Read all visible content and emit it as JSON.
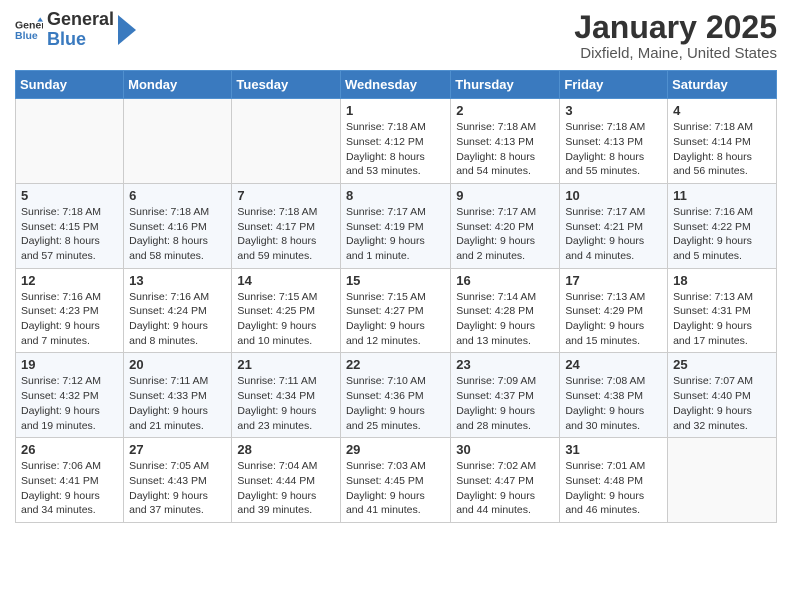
{
  "header": {
    "logo_general": "General",
    "logo_blue": "Blue",
    "month_title": "January 2025",
    "location": "Dixfield, Maine, United States"
  },
  "weekdays": [
    "Sunday",
    "Monday",
    "Tuesday",
    "Wednesday",
    "Thursday",
    "Friday",
    "Saturday"
  ],
  "weeks": [
    [
      {
        "day": "",
        "info": ""
      },
      {
        "day": "",
        "info": ""
      },
      {
        "day": "",
        "info": ""
      },
      {
        "day": "1",
        "info": "Sunrise: 7:18 AM\nSunset: 4:12 PM\nDaylight: 8 hours\nand 53 minutes."
      },
      {
        "day": "2",
        "info": "Sunrise: 7:18 AM\nSunset: 4:13 PM\nDaylight: 8 hours\nand 54 minutes."
      },
      {
        "day": "3",
        "info": "Sunrise: 7:18 AM\nSunset: 4:13 PM\nDaylight: 8 hours\nand 55 minutes."
      },
      {
        "day": "4",
        "info": "Sunrise: 7:18 AM\nSunset: 4:14 PM\nDaylight: 8 hours\nand 56 minutes."
      }
    ],
    [
      {
        "day": "5",
        "info": "Sunrise: 7:18 AM\nSunset: 4:15 PM\nDaylight: 8 hours\nand 57 minutes."
      },
      {
        "day": "6",
        "info": "Sunrise: 7:18 AM\nSunset: 4:16 PM\nDaylight: 8 hours\nand 58 minutes."
      },
      {
        "day": "7",
        "info": "Sunrise: 7:18 AM\nSunset: 4:17 PM\nDaylight: 8 hours\nand 59 minutes."
      },
      {
        "day": "8",
        "info": "Sunrise: 7:17 AM\nSunset: 4:19 PM\nDaylight: 9 hours\nand 1 minute."
      },
      {
        "day": "9",
        "info": "Sunrise: 7:17 AM\nSunset: 4:20 PM\nDaylight: 9 hours\nand 2 minutes."
      },
      {
        "day": "10",
        "info": "Sunrise: 7:17 AM\nSunset: 4:21 PM\nDaylight: 9 hours\nand 4 minutes."
      },
      {
        "day": "11",
        "info": "Sunrise: 7:16 AM\nSunset: 4:22 PM\nDaylight: 9 hours\nand 5 minutes."
      }
    ],
    [
      {
        "day": "12",
        "info": "Sunrise: 7:16 AM\nSunset: 4:23 PM\nDaylight: 9 hours\nand 7 minutes."
      },
      {
        "day": "13",
        "info": "Sunrise: 7:16 AM\nSunset: 4:24 PM\nDaylight: 9 hours\nand 8 minutes."
      },
      {
        "day": "14",
        "info": "Sunrise: 7:15 AM\nSunset: 4:25 PM\nDaylight: 9 hours\nand 10 minutes."
      },
      {
        "day": "15",
        "info": "Sunrise: 7:15 AM\nSunset: 4:27 PM\nDaylight: 9 hours\nand 12 minutes."
      },
      {
        "day": "16",
        "info": "Sunrise: 7:14 AM\nSunset: 4:28 PM\nDaylight: 9 hours\nand 13 minutes."
      },
      {
        "day": "17",
        "info": "Sunrise: 7:13 AM\nSunset: 4:29 PM\nDaylight: 9 hours\nand 15 minutes."
      },
      {
        "day": "18",
        "info": "Sunrise: 7:13 AM\nSunset: 4:31 PM\nDaylight: 9 hours\nand 17 minutes."
      }
    ],
    [
      {
        "day": "19",
        "info": "Sunrise: 7:12 AM\nSunset: 4:32 PM\nDaylight: 9 hours\nand 19 minutes."
      },
      {
        "day": "20",
        "info": "Sunrise: 7:11 AM\nSunset: 4:33 PM\nDaylight: 9 hours\nand 21 minutes."
      },
      {
        "day": "21",
        "info": "Sunrise: 7:11 AM\nSunset: 4:34 PM\nDaylight: 9 hours\nand 23 minutes."
      },
      {
        "day": "22",
        "info": "Sunrise: 7:10 AM\nSunset: 4:36 PM\nDaylight: 9 hours\nand 25 minutes."
      },
      {
        "day": "23",
        "info": "Sunrise: 7:09 AM\nSunset: 4:37 PM\nDaylight: 9 hours\nand 28 minutes."
      },
      {
        "day": "24",
        "info": "Sunrise: 7:08 AM\nSunset: 4:38 PM\nDaylight: 9 hours\nand 30 minutes."
      },
      {
        "day": "25",
        "info": "Sunrise: 7:07 AM\nSunset: 4:40 PM\nDaylight: 9 hours\nand 32 minutes."
      }
    ],
    [
      {
        "day": "26",
        "info": "Sunrise: 7:06 AM\nSunset: 4:41 PM\nDaylight: 9 hours\nand 34 minutes."
      },
      {
        "day": "27",
        "info": "Sunrise: 7:05 AM\nSunset: 4:43 PM\nDaylight: 9 hours\nand 37 minutes."
      },
      {
        "day": "28",
        "info": "Sunrise: 7:04 AM\nSunset: 4:44 PM\nDaylight: 9 hours\nand 39 minutes."
      },
      {
        "day": "29",
        "info": "Sunrise: 7:03 AM\nSunset: 4:45 PM\nDaylight: 9 hours\nand 41 minutes."
      },
      {
        "day": "30",
        "info": "Sunrise: 7:02 AM\nSunset: 4:47 PM\nDaylight: 9 hours\nand 44 minutes."
      },
      {
        "day": "31",
        "info": "Sunrise: 7:01 AM\nSunset: 4:48 PM\nDaylight: 9 hours\nand 46 minutes."
      },
      {
        "day": "",
        "info": ""
      }
    ]
  ]
}
